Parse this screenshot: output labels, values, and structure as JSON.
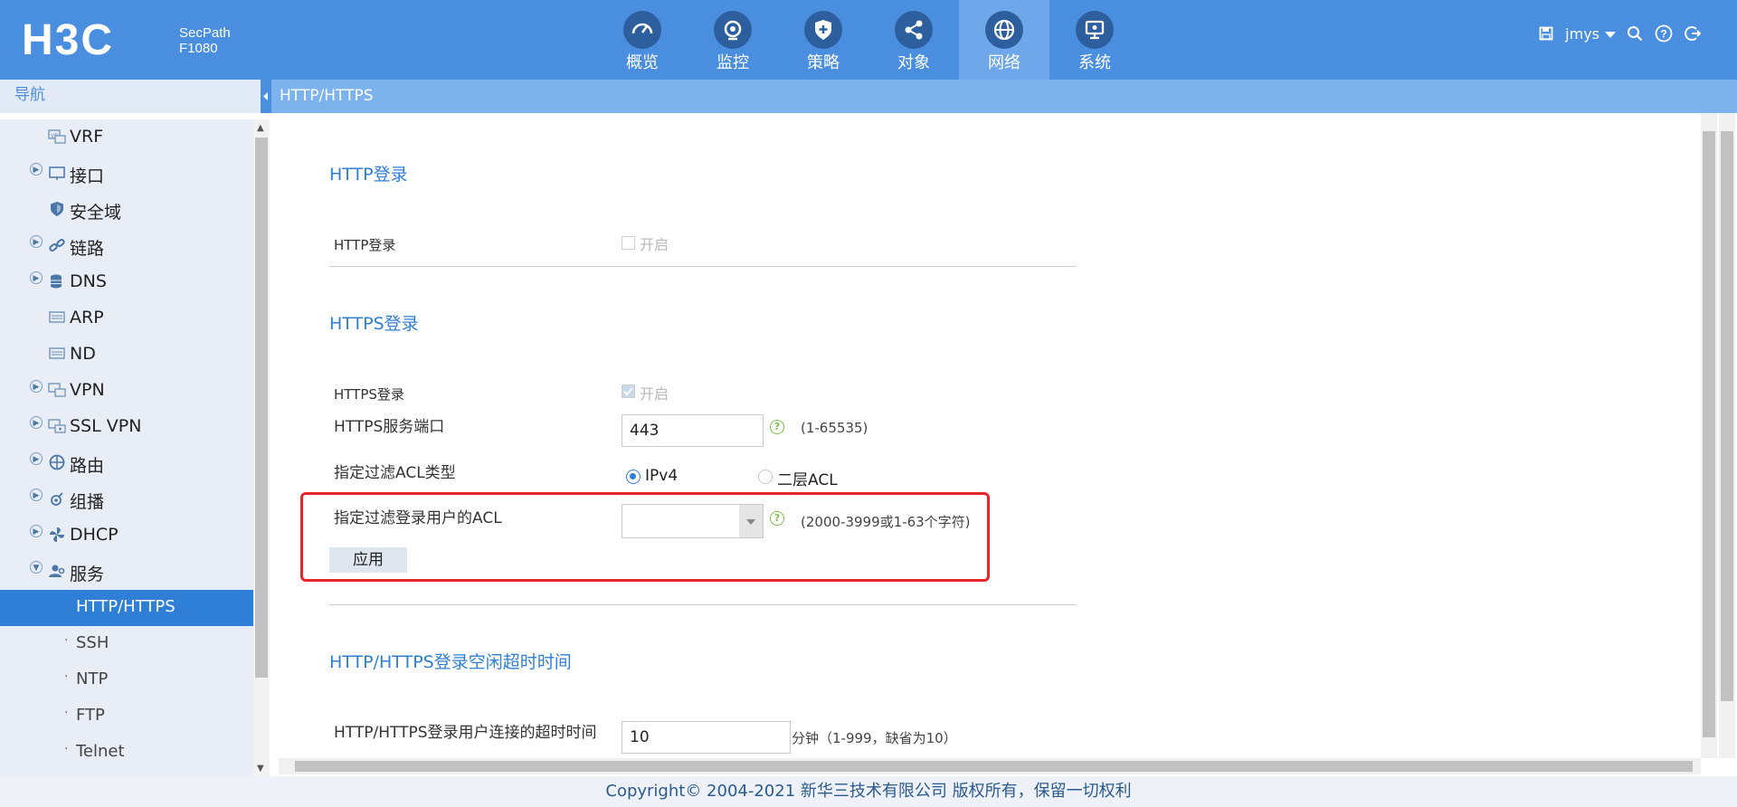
{
  "brand": {
    "logo_text": "H3C",
    "product_line1": "SecPath",
    "product_line2": "F1080"
  },
  "topnav": [
    {
      "label": "概览",
      "icon": "dashboard-icon"
    },
    {
      "label": "监控",
      "icon": "monitor-icon"
    },
    {
      "label": "策略",
      "icon": "shield-icon"
    },
    {
      "label": "对象",
      "icon": "share-icon"
    },
    {
      "label": "网络",
      "icon": "globe-icon",
      "active": true
    },
    {
      "label": "系统",
      "icon": "screen-icon"
    }
  ],
  "user": {
    "name": "jmys"
  },
  "sidebar": {
    "header": "导航",
    "items": [
      {
        "label": "VRF",
        "icon": "vrf-icon",
        "expandable": false
      },
      {
        "label": "接口",
        "icon": "interface-icon",
        "expandable": true
      },
      {
        "label": "安全域",
        "icon": "security-zone-icon",
        "expandable": false
      },
      {
        "label": "链路",
        "icon": "link-icon",
        "expandable": true
      },
      {
        "label": "DNS",
        "icon": "database-icon",
        "expandable": true
      },
      {
        "label": "ARP",
        "icon": "arp-icon",
        "expandable": false
      },
      {
        "label": "ND",
        "icon": "nd-icon",
        "expandable": false
      },
      {
        "label": "VPN",
        "icon": "vpn-icon",
        "expandable": true
      },
      {
        "label": "SSL VPN",
        "icon": "sslvpn-icon",
        "expandable": true
      },
      {
        "label": "路由",
        "icon": "route-icon",
        "expandable": true
      },
      {
        "label": "组播",
        "icon": "multicast-icon",
        "expandable": true
      },
      {
        "label": "DHCP",
        "icon": "dhcp-icon",
        "expandable": true
      },
      {
        "label": "服务",
        "icon": "service-icon",
        "expandable": true
      }
    ],
    "subitems": [
      {
        "label": "HTTP/HTTPS",
        "selected": true
      },
      {
        "label": "SSH"
      },
      {
        "label": "NTP"
      },
      {
        "label": "FTP"
      },
      {
        "label": "Telnet"
      }
    ]
  },
  "page": {
    "title": "HTTP/HTTPS"
  },
  "http": {
    "section": "HTTP登录",
    "label": "HTTP登录",
    "enable_label": "开启",
    "enabled": false
  },
  "https": {
    "section": "HTTPS登录",
    "label": "HTTPS登录",
    "enable_label": "开启",
    "enabled": true,
    "port_label": "HTTPS服务端口",
    "port_value": "443",
    "port_hint": "(1-65535)",
    "acl_type_label": "指定过滤ACL类型",
    "acl_type_options": [
      "IPv4",
      "二层ACL"
    ],
    "acl_type_selected": "IPv4",
    "acl_label": "指定过滤登录用户的ACL",
    "acl_value": "",
    "acl_hint": "(2000-3999或1-63个字符)",
    "apply_label": "应用"
  },
  "timeout": {
    "section": "HTTP/HTTPS登录空闲超时时间",
    "label": "HTTP/HTTPS登录用户连接的超时时间",
    "value": "10",
    "hint": "分钟（1-999，缺省为10）"
  },
  "footer": {
    "text": "Copyright© 2004-2021 新华三技术有限公司 版权所有，保留一切权利"
  },
  "colors": {
    "topbar": "#4a8fdf",
    "active_nav": "#2f7fd6",
    "highlight_box": "#e8262a",
    "help_icon": "#7cc04b"
  }
}
